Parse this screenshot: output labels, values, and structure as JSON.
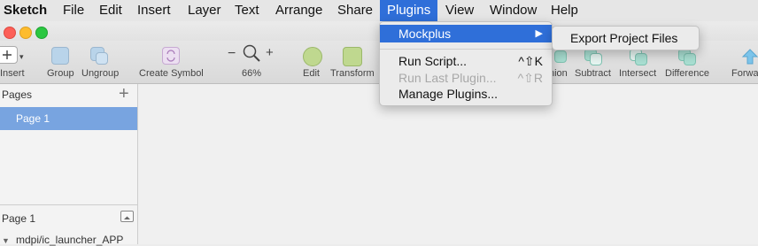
{
  "menubar": {
    "app": "Sketch",
    "items": [
      "File",
      "Edit",
      "Insert",
      "Layer",
      "Text",
      "Arrange",
      "Share",
      "Plugins",
      "View",
      "Window",
      "Help"
    ]
  },
  "toolbar": {
    "insert": "Insert",
    "group": "Group",
    "ungroup": "Ungroup",
    "create_symbol": "Create Symbol",
    "zoom_minus": "−",
    "zoom_plus": "+",
    "zoom": "66%",
    "edit": "Edit",
    "transform": "Transform",
    "union_partial": "nion",
    "subtract": "Subtract",
    "intersect": "Intersect",
    "difference": "Difference",
    "forward_partial": "Forwa"
  },
  "sidebar": {
    "pages_header": "Pages",
    "add_symbol": "+",
    "page_1": "Page 1",
    "layers_header": "Page 1",
    "layer_item": "mdpi/ic_launcher_APP"
  },
  "plugins_menu": {
    "mockplus": "Mockplus",
    "run_script": "Run Script...",
    "run_script_shortcut": "^⇧K",
    "run_last": "Run Last Plugin...",
    "run_last_shortcut": "^⇧R",
    "manage": "Manage Plugins..."
  },
  "submenu": {
    "export": "Export Project Files"
  },
  "colors": {
    "highlight": "#2f6fd9",
    "selection": "#78a4e0"
  }
}
